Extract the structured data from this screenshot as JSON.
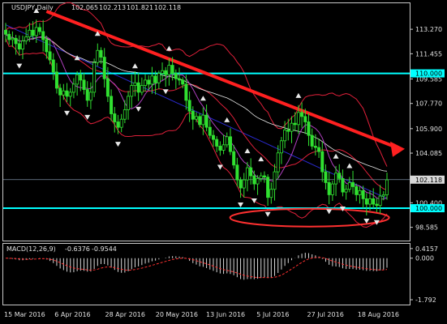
{
  "chart_data": [
    {
      "type": "candlestick",
      "symbol": "USDJPY",
      "timeframe": "Daily",
      "title": "USDJPY,Daily",
      "ohlc_header": [
        "102.065",
        "102.213",
        "101.821",
        "102.118"
      ],
      "ylim": [
        97.6,
        115.2
      ],
      "price_axis_ticks": [
        {
          "label": "113.270",
          "value": 113.27
        },
        {
          "label": "111.455",
          "value": 111.455
        },
        {
          "label": "109.585",
          "value": 109.585
        },
        {
          "label": "107.770",
          "value": 107.77
        },
        {
          "label": "105.900",
          "value": 105.9
        },
        {
          "label": "104.085",
          "value": 104.085
        },
        {
          "label": "100.400",
          "value": 100.4
        },
        {
          "label": "98.585",
          "value": 98.585
        }
      ],
      "highlighted_levels": [
        {
          "label": "110.000",
          "value": 110.0,
          "color": "#00ffff"
        },
        {
          "label": "100.000",
          "value": 100.0,
          "color": "#00ffff"
        }
      ],
      "current_price": {
        "label": "102.118",
        "value": 102.118
      },
      "x_labels": [
        "15 Mar 2016",
        "6 Apr 2016",
        "28 Apr 2016",
        "20 May 2016",
        "13 Jun 2016",
        "5 Jul 2016",
        "27 Jul 2016",
        "18 Aug 2016"
      ],
      "closes": [
        112.9,
        112.5,
        112.6,
        112.2,
        111.8,
        112.4,
        112.7,
        113.2,
        112.8,
        113.4,
        113.1,
        112.5,
        111.6,
        111.0,
        110.1,
        108.9,
        108.4,
        108.7,
        108.3,
        108.6,
        109.2,
        109.9,
        109.5,
        108.8,
        108.0,
        108.6,
        110.8,
        111.7,
        111.2,
        109.6,
        108.3,
        107.0,
        106.4,
        106.0,
        106.6,
        107.3,
        108.3,
        109.1,
        109.3,
        108.6,
        109.1,
        109.5,
        109.2,
        109.8,
        109.3,
        110.0,
        110.2,
        109.9,
        110.6,
        110.0,
        109.6,
        109.5,
        109.2,
        108.0,
        107.2,
        106.6,
        106.8,
        106.2,
        106.9,
        106.0,
        105.4,
        105.1,
        104.6,
        104.3,
        104.7,
        105.3,
        104.2,
        103.2,
        102.1,
        101.5,
        102.1,
        103.0,
        102.4,
        101.8,
        102.2,
        102.4,
        102.3,
        100.8,
        101.4,
        102.7,
        104.1,
        105.0,
        105.8,
        105.7,
        106.3,
        106.2,
        107.1,
        106.8,
        106.4,
        105.4,
        104.6,
        104.5,
        104.2,
        102.7,
        101.9,
        101.0,
        101.8,
        102.6,
        102.2,
        101.2,
        101.4,
        101.9,
        101.6,
        101.0,
        101.3,
        100.7,
        100.3,
        100.7,
        100.3,
        100.2,
        100.9,
        101.0,
        102.1
      ],
      "indicators": [
        "Bollinger Bands",
        "Moving averages"
      ],
      "annotations": [
        "downtrend arrow",
        "support ellipse near 100.000"
      ]
    },
    {
      "type": "bar",
      "title": "MACD(12,26,9)",
      "values_header": [
        "-0.6376",
        "-0.9544"
      ],
      "axis_ticks": [
        {
          "label": "0.4157",
          "value": 0.4157
        },
        {
          "label": "0.000",
          "value": 0.0
        },
        {
          "label": "-1.792",
          "value": -1.792
        }
      ],
      "series": [
        {
          "name": "MACD",
          "style": "histogram"
        },
        {
          "name": "Signal",
          "style": "dashed line",
          "color": "#ff3030"
        }
      ]
    }
  ]
}
